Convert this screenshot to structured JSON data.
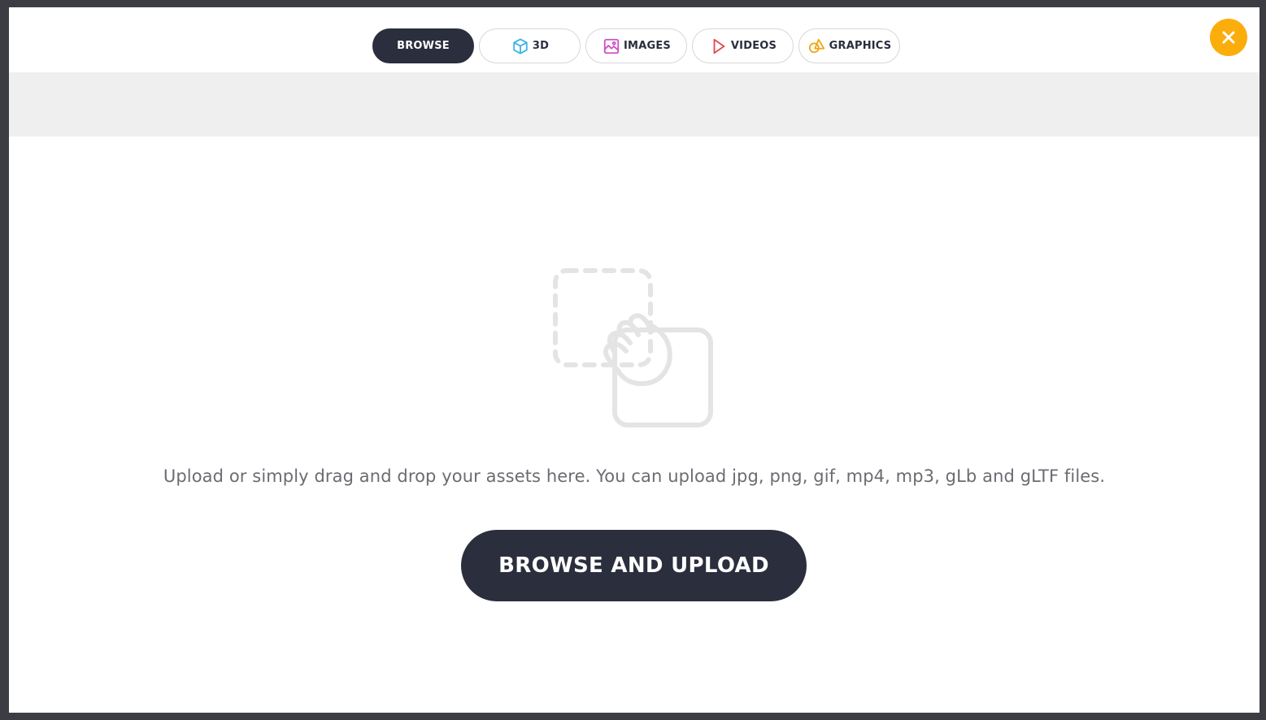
{
  "tabs": [
    {
      "label": "BROWSE",
      "icon": "",
      "active": true
    },
    {
      "label": "3D",
      "icon": "cube-icon",
      "color": "#3fb3e6"
    },
    {
      "label": "IMAGES",
      "icon": "image-icon",
      "color": "#d04fc6"
    },
    {
      "label": "VIDEOS",
      "icon": "play-icon",
      "color": "#e5484d"
    },
    {
      "label": "GRAPHICS",
      "icon": "shapes-icon",
      "color": "#f2a818"
    }
  ],
  "close": {
    "icon": "close-icon",
    "color": "#fbad0c"
  },
  "dropzone": {
    "icon": "drag-drop-icon",
    "text": "Upload or simply drag and drop your assets here. You can upload jpg, png, gif, mp4, mp3, gLb and gLTF files.",
    "button_label": "BROWSE AND UPLOAD"
  },
  "colors": {
    "primary_dark": "#2b2e3d",
    "accent": "#fbad0c",
    "muted_text": "#6b6c72",
    "panel_gray": "#efefef"
  }
}
